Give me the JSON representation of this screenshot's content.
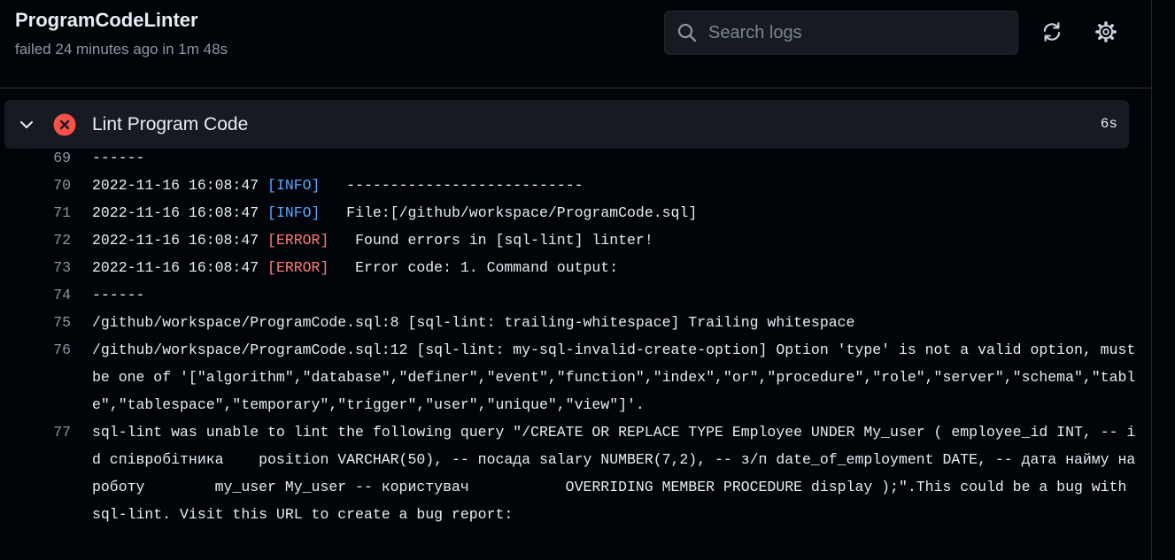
{
  "header": {
    "title": "ProgramCodeLinter",
    "status": "failed 24 minutes ago in 1m 48s",
    "search_placeholder": "Search logs",
    "refresh_icon": "refresh-icon",
    "settings_icon": "gear-icon"
  },
  "step": {
    "name": "Lint Program Code",
    "duration": "6s",
    "status_icon": "x-circle-icon",
    "status_color": "#f85149",
    "expanded": true
  },
  "colors": {
    "info": "#58a6ff",
    "error": "#ff7b72",
    "background": "#010409",
    "step_background": "#161b22"
  },
  "log": {
    "lines": [
      {
        "num": "69",
        "text": "------"
      },
      {
        "num": "70",
        "ts": "2022-11-16 16:08:47 ",
        "tag": "[INFO]",
        "level": "info",
        "msg": "   ---------------------------"
      },
      {
        "num": "71",
        "ts": "2022-11-16 16:08:47 ",
        "tag": "[INFO]",
        "level": "info",
        "msg": "   File:[/github/workspace/ProgramCode.sql]"
      },
      {
        "num": "72",
        "ts": "2022-11-16 16:08:47 ",
        "tag": "[ERROR]",
        "level": "error",
        "msg": "   Found errors in [sql-lint] linter!"
      },
      {
        "num": "73",
        "ts": "2022-11-16 16:08:47 ",
        "tag": "[ERROR]",
        "level": "error",
        "msg": "   Error code: 1. Command output:"
      },
      {
        "num": "74",
        "text": "------"
      },
      {
        "num": "75",
        "text": "/github/workspace/ProgramCode.sql:8 [sql-lint: trailing-whitespace] Trailing whitespace"
      },
      {
        "num": "76",
        "text": "/github/workspace/ProgramCode.sql:12 [sql-lint: my-sql-invalid-create-option] Option 'type' is not a valid option, must be one of '[\"algorithm\",\"database\",\"definer\",\"event\",\"function\",\"index\",\"or\",\"procedure\",\"role\",\"server\",\"schema\",\"table\",\"tablespace\",\"temporary\",\"trigger\",\"user\",\"unique\",\"view\"]'."
      },
      {
        "num": "77",
        "text": "sql-lint was unable to lint the following query \"/CREATE OR REPLACE TYPE Employee UNDER My_user ( employee_id INT, -- id співробітника    position VARCHAR(50), -- посада salary NUMBER(7,2), -- з/п date_of_employment DATE, -- дата найму на роботу        my_user My_user -- користувач           OVERRIDING MEMBER PROCEDURE display );\".This could be a bug with sql-lint. Visit this URL to create a bug report:"
      }
    ]
  }
}
